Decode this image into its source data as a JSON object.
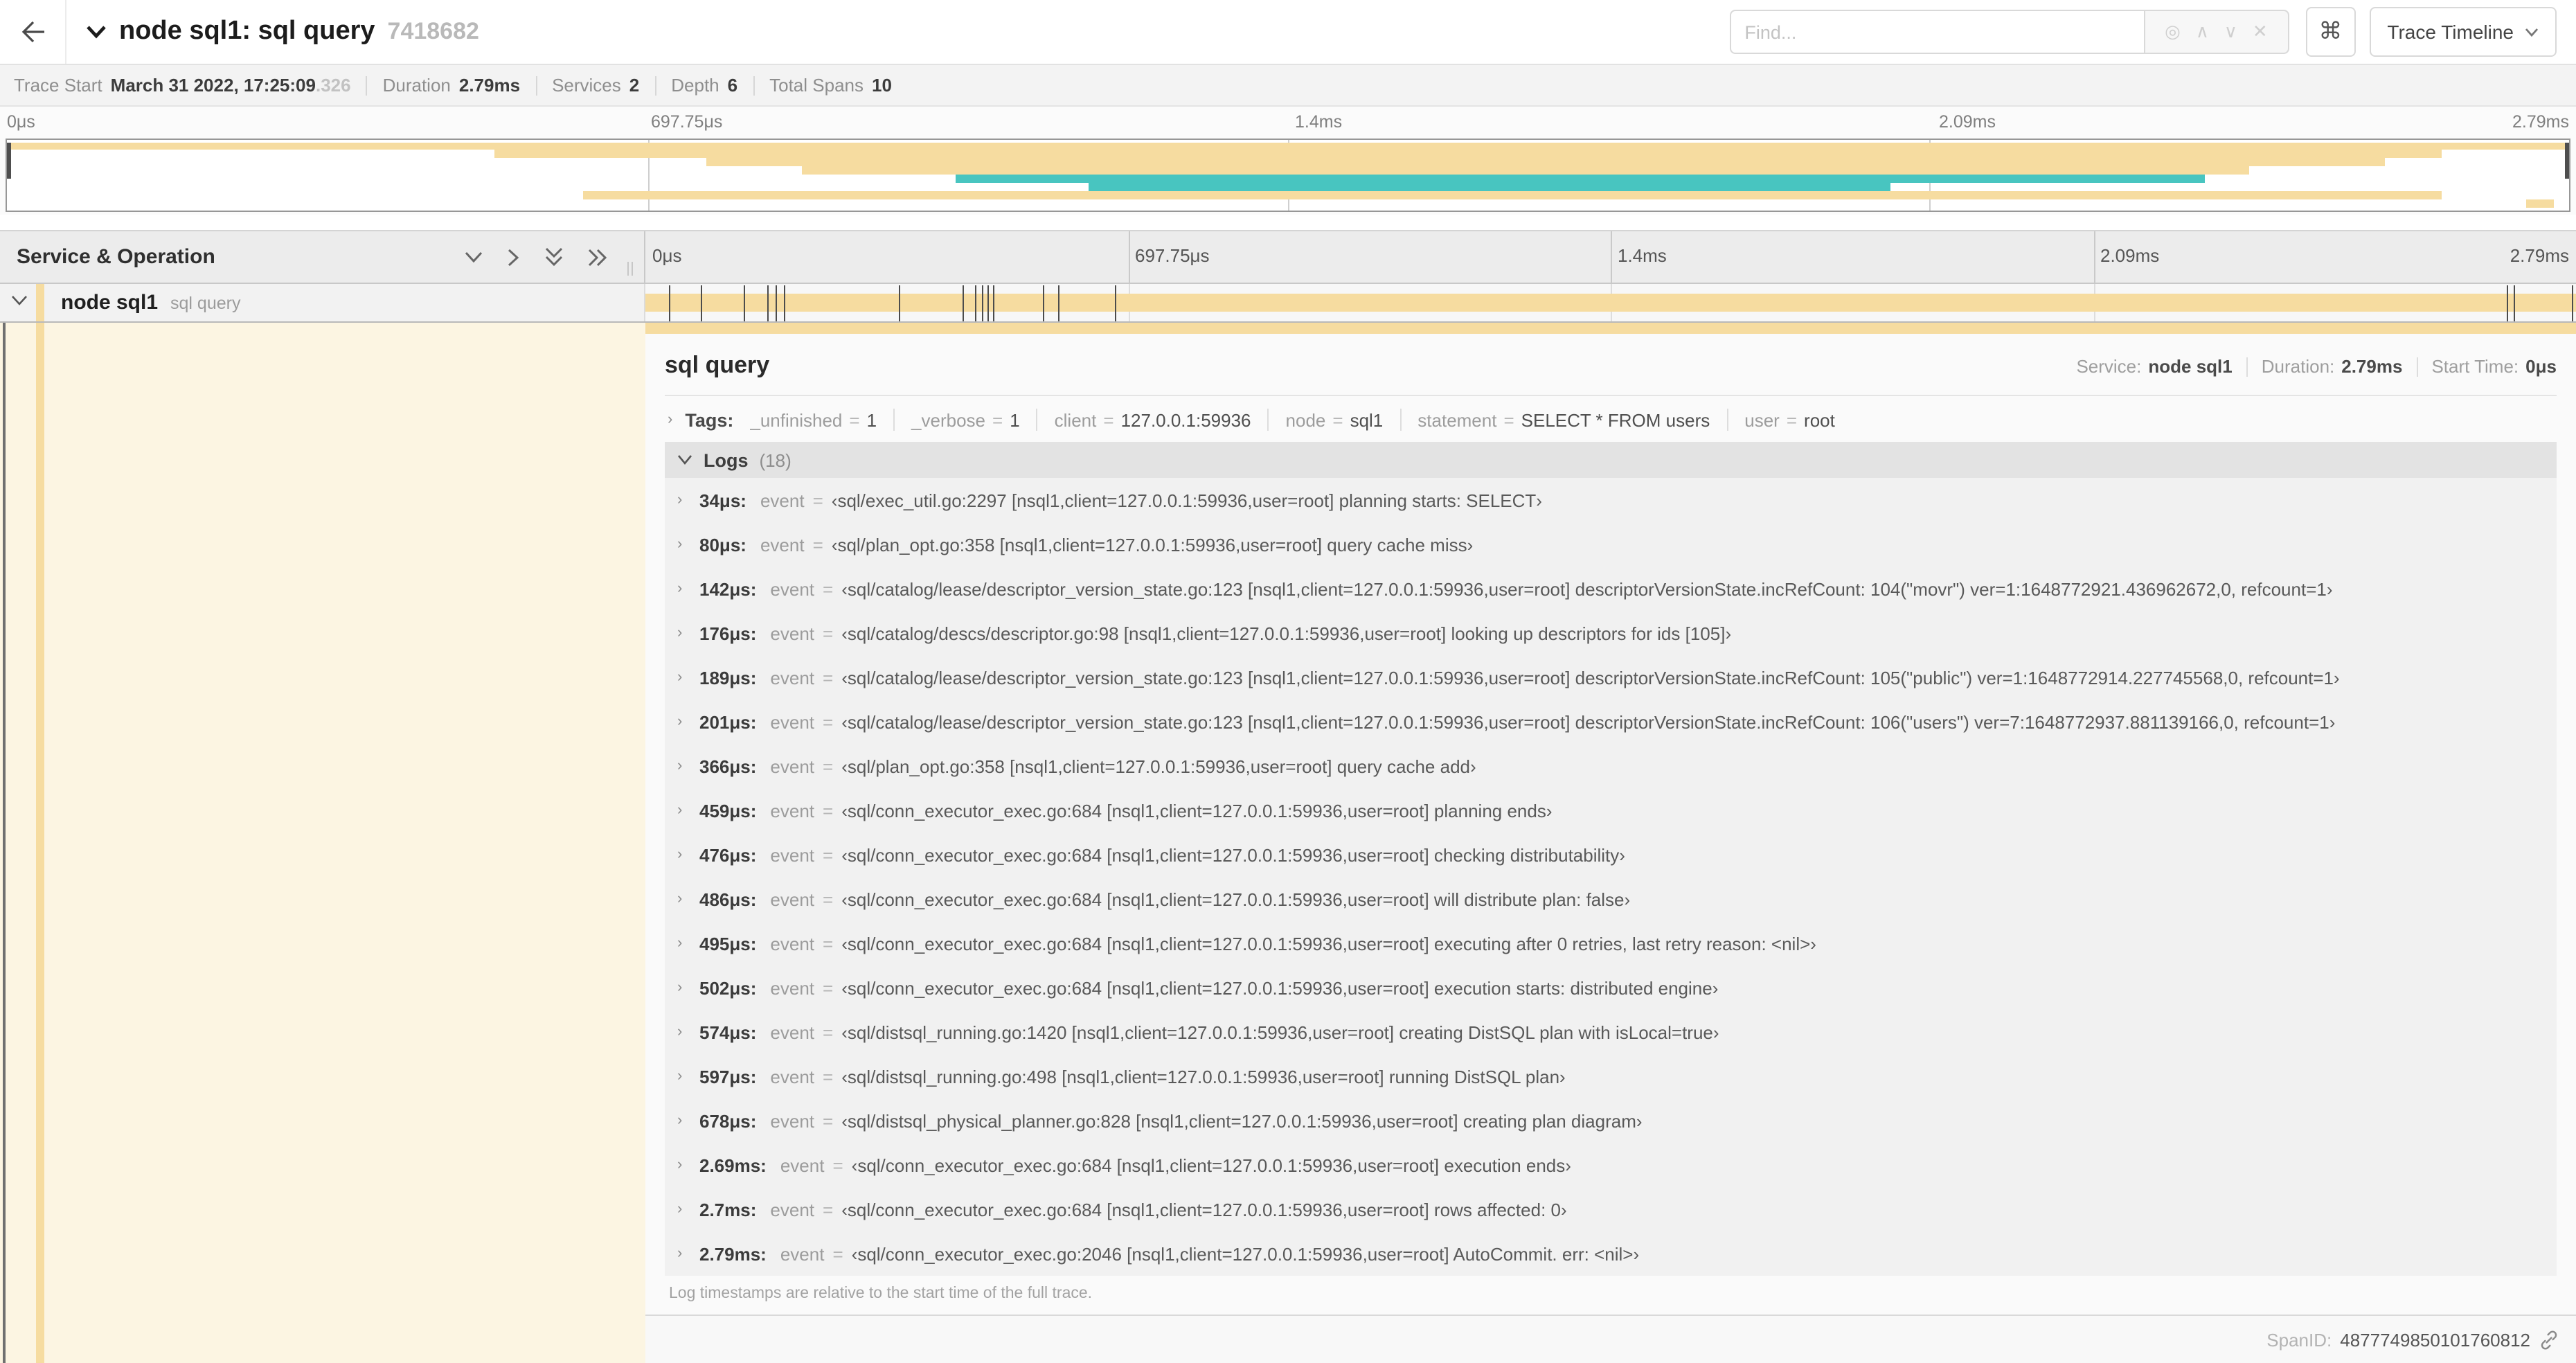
{
  "colors": {
    "tan": "#F6DCA0",
    "teal": "#48C5C0",
    "cream": "#FCF5E2"
  },
  "header": {
    "title": "node sql1: sql query",
    "trace_id_short": "7418682",
    "find_placeholder": "Find...",
    "shortcut_glyph": "⌘",
    "view_select_label": "Trace Timeline",
    "find_tool_glyphs": [
      "◎",
      "∧",
      "∨",
      "✕"
    ]
  },
  "summary": [
    {
      "label": "Trace Start",
      "value": "March 31 2022, 17:25:09",
      "suffix": ".326"
    },
    {
      "label": "Duration",
      "value": "2.79ms"
    },
    {
      "label": "Services",
      "value": "2"
    },
    {
      "label": "Depth",
      "value": "6"
    },
    {
      "label": "Total Spans",
      "value": "10"
    }
  ],
  "minimap": {
    "axis_ticks": [
      {
        "label": "0μs",
        "pct": 0
      },
      {
        "label": "697.75μs",
        "pct": 25
      },
      {
        "label": "1.4ms",
        "pct": 50
      },
      {
        "label": "2.09ms",
        "pct": 75
      },
      {
        "label": "2.79ms",
        "pct": 100,
        "align": "right"
      }
    ],
    "rows": [
      {
        "start": 0,
        "end": 100,
        "color": "tan"
      },
      {
        "start": 19,
        "end": 95,
        "color": "tan"
      },
      {
        "start": 27.3,
        "end": 92.8,
        "color": "tan"
      },
      {
        "start": 31,
        "end": 87.5,
        "color": "tan"
      },
      {
        "start": 37,
        "end": 85.8,
        "color": "teal"
      },
      {
        "start": 42.2,
        "end": 73.5,
        "color": "teal"
      },
      {
        "start": 22.5,
        "end": 95,
        "color": "tan"
      },
      {
        "start": 98.3,
        "end": 99.4,
        "color": "tan"
      }
    ]
  },
  "timeline": {
    "left_header": "Service & Operation",
    "axis_ticks": [
      {
        "label": "0μs",
        "pct": 0
      },
      {
        "label": "697.75μs",
        "pct": 25
      },
      {
        "label": "1.4ms",
        "pct": 50
      },
      {
        "label": "2.09ms",
        "pct": 75
      },
      {
        "label": "2.79ms",
        "pct": 100,
        "align": "right"
      }
    ],
    "span_row": {
      "service": "node sql1",
      "operation": "sql query",
      "bar": {
        "start": 0,
        "end": 100,
        "color": "tan"
      },
      "log_ticks_pct": [
        1.22,
        2.87,
        5.09,
        6.31,
        6.77,
        7.2,
        13.12,
        16.45,
        17.06,
        17.42,
        17.74,
        17.99,
        20.57,
        21.4,
        24.3,
        96.42,
        96.77,
        99.8
      ]
    }
  },
  "detail": {
    "title": "sql query",
    "meta": [
      {
        "label": "Service:",
        "value": "node sql1"
      },
      {
        "label": "Duration:",
        "value": "2.79ms"
      },
      {
        "label": "Start Time:",
        "value": "0μs"
      }
    ],
    "tags_label": "Tags:",
    "tags": [
      {
        "key": "_unfinished",
        "value": "1"
      },
      {
        "key": "_verbose",
        "value": "1"
      },
      {
        "key": "client",
        "value": "127.0.0.1:59936"
      },
      {
        "key": "node",
        "value": "sql1"
      },
      {
        "key": "statement",
        "value": "SELECT * FROM users"
      },
      {
        "key": "user",
        "value": "root"
      }
    ],
    "logs_label": "Logs",
    "logs_count": "(18)",
    "log_field": "event",
    "logs": [
      {
        "time": "34μs:",
        "value": "‹sql/exec_util.go:2297 [nsql1,client=127.0.0.1:59936,user=root] planning starts: SELECT›"
      },
      {
        "time": "80μs:",
        "value": "‹sql/plan_opt.go:358 [nsql1,client=127.0.0.1:59936,user=root] query cache miss›"
      },
      {
        "time": "142μs:",
        "value": "‹sql/catalog/lease/descriptor_version_state.go:123 [nsql1,client=127.0.0.1:59936,user=root] descriptorVersionState.incRefCount: 104(\"movr\") ver=1:1648772921.436962672,0, refcount=1›"
      },
      {
        "time": "176μs:",
        "value": "‹sql/catalog/descs/descriptor.go:98 [nsql1,client=127.0.0.1:59936,user=root] looking up descriptors for ids [105]›"
      },
      {
        "time": "189μs:",
        "value": "‹sql/catalog/lease/descriptor_version_state.go:123 [nsql1,client=127.0.0.1:59936,user=root] descriptorVersionState.incRefCount: 105(\"public\") ver=1:1648772914.227745568,0, refcount=1›"
      },
      {
        "time": "201μs:",
        "value": "‹sql/catalog/lease/descriptor_version_state.go:123 [nsql1,client=127.0.0.1:59936,user=root] descriptorVersionState.incRefCount: 106(\"users\") ver=7:1648772937.881139166,0, refcount=1›"
      },
      {
        "time": "366μs:",
        "value": "‹sql/plan_opt.go:358 [nsql1,client=127.0.0.1:59936,user=root] query cache add›"
      },
      {
        "time": "459μs:",
        "value": "‹sql/conn_executor_exec.go:684 [nsql1,client=127.0.0.1:59936,user=root] planning ends›"
      },
      {
        "time": "476μs:",
        "value": "‹sql/conn_executor_exec.go:684 [nsql1,client=127.0.0.1:59936,user=root] checking distributability›"
      },
      {
        "time": "486μs:",
        "value": "‹sql/conn_executor_exec.go:684 [nsql1,client=127.0.0.1:59936,user=root] will distribute plan: false›"
      },
      {
        "time": "495μs:",
        "value": "‹sql/conn_executor_exec.go:684 [nsql1,client=127.0.0.1:59936,user=root] executing after 0 retries, last retry reason: <nil>›"
      },
      {
        "time": "502μs:",
        "value": "‹sql/conn_executor_exec.go:684 [nsql1,client=127.0.0.1:59936,user=root] execution starts: distributed engine›"
      },
      {
        "time": "574μs:",
        "value": "‹sql/distsql_running.go:1420 [nsql1,client=127.0.0.1:59936,user=root] creating DistSQL plan with isLocal=true›"
      },
      {
        "time": "597μs:",
        "value": "‹sql/distsql_running.go:498 [nsql1,client=127.0.0.1:59936,user=root] running DistSQL plan›"
      },
      {
        "time": "678μs:",
        "value": "‹sql/distsql_physical_planner.go:828 [nsql1,client=127.0.0.1:59936,user=root] creating plan diagram›"
      },
      {
        "time": "2.69ms:",
        "value": "‹sql/conn_executor_exec.go:684 [nsql1,client=127.0.0.1:59936,user=root] execution ends›"
      },
      {
        "time": "2.7ms:",
        "value": "‹sql/conn_executor_exec.go:684 [nsql1,client=127.0.0.1:59936,user=root] rows affected: 0›"
      },
      {
        "time": "2.79ms:",
        "value": "‹sql/conn_executor_exec.go:2046 [nsql1,client=127.0.0.1:59936,user=root] AutoCommit. err: <nil>›"
      }
    ],
    "logs_note": "Log timestamps are relative to the start time of the full trace.",
    "spanid_label": "SpanID:",
    "spanid_value": "4877749850101760812"
  }
}
